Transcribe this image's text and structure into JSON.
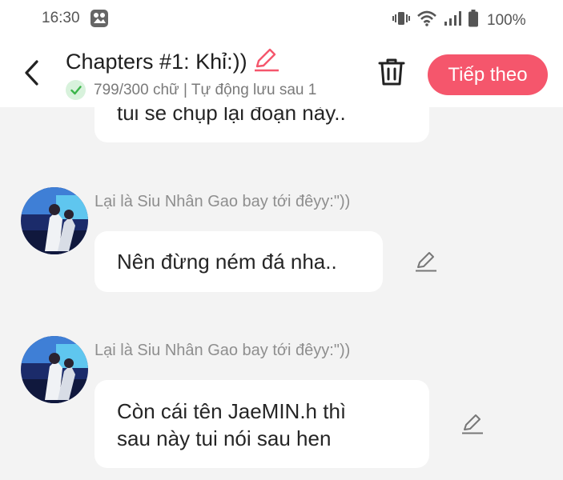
{
  "status_bar": {
    "time": "16:30",
    "battery": "100%",
    "icons": [
      "gallery-app-icon",
      "vibrate-icon",
      "wifi-icon",
      "signal-icon",
      "battery-icon"
    ]
  },
  "header": {
    "title": "Chapters #1: Khỉ:))",
    "subtitle": "799/300 chữ | Tự động lưu sau 1",
    "next_button": "Tiếp theo",
    "accent_color": "#f5566c",
    "icons": [
      "back-arrow-icon",
      "pencil-icon",
      "check-icon",
      "trash-icon"
    ]
  },
  "messages": [
    {
      "text": "tui se chụp lại đoạn này.."
    },
    {
      "sender": "Lại là Siu Nhân Gao bay tới đêyy:\"))",
      "text": "Nên đừng ném đá nha.."
    },
    {
      "sender": "Lại là Siu Nhân Gao bay tới đêyy:\"))",
      "text_line1": "Còn cái tên JaeMIN.h thì",
      "text_line2": "sau này tui nói sau hen"
    }
  ]
}
